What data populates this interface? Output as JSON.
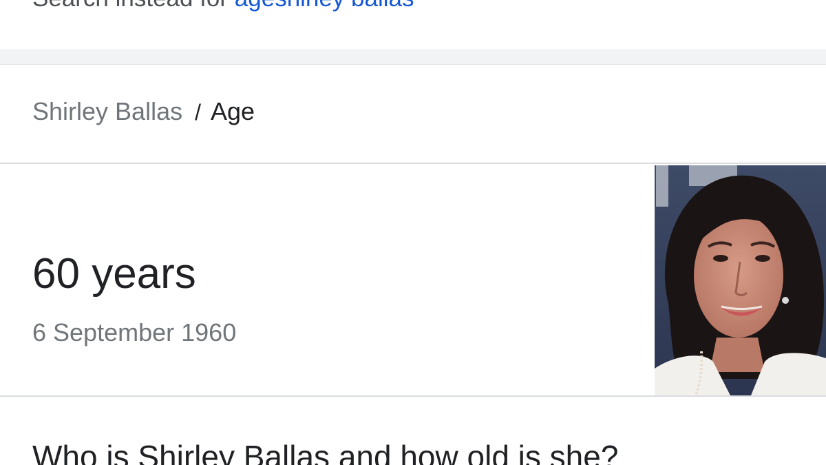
{
  "spelling": {
    "prefix": "Search instead for",
    "suggestion_link": "ageshirley ballas"
  },
  "breadcrumb": {
    "parent": "Shirley Ballas",
    "separator": "/",
    "current": "Age"
  },
  "answer": {
    "value": "60 years",
    "birth_date": "6 September 1960"
  },
  "related_question": {
    "text": "Who is Shirley Ballas and how old is she?"
  },
  "colors": {
    "link": "#1558d6",
    "primary_text": "#202124",
    "secondary_text": "#70757a",
    "divider": "#dadce0",
    "band": "#f1f3f4"
  }
}
